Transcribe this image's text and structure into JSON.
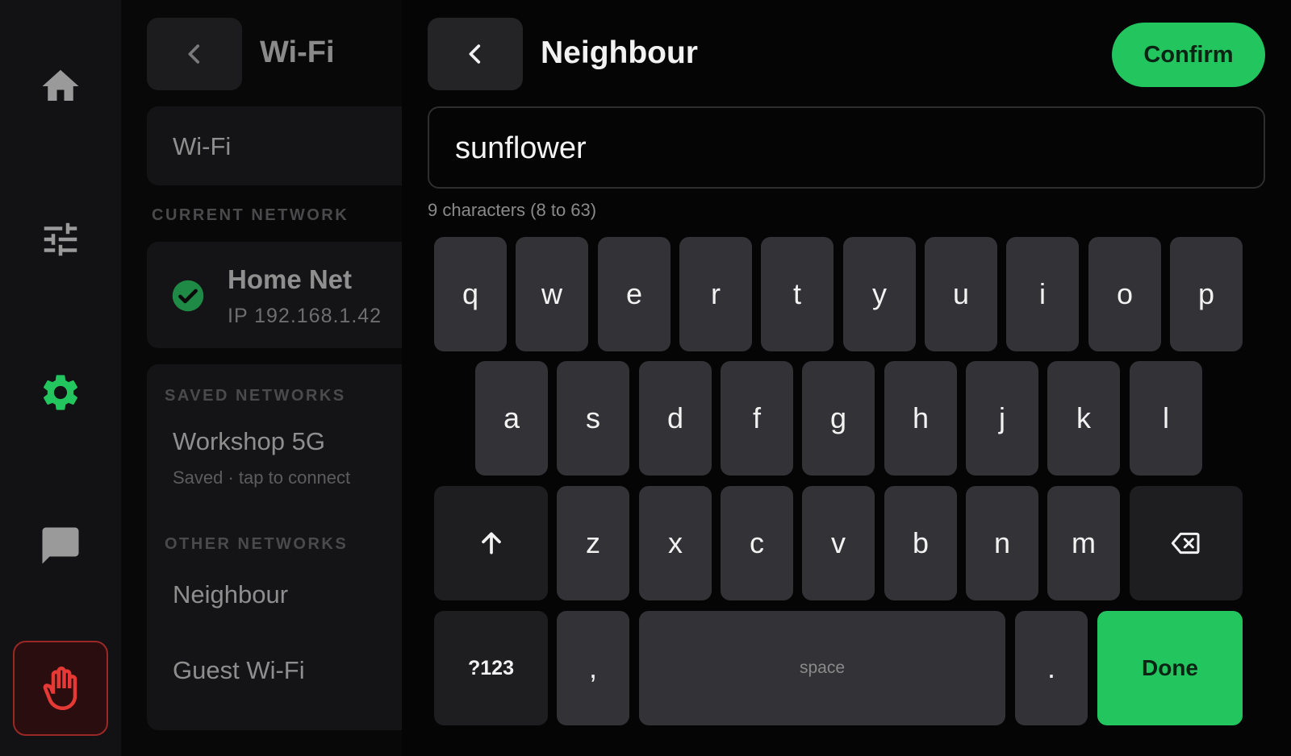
{
  "rail": {
    "items": [
      {
        "icon": "home-icon",
        "color": "#9a9a9a"
      },
      {
        "icon": "sliders-icon",
        "color": "#9a9a9a"
      },
      {
        "icon": "gear-icon",
        "color": "#22c55e"
      },
      {
        "icon": "chat-icon",
        "color": "#9a9a9a"
      }
    ],
    "estop": {
      "icon": "hand-stop-icon",
      "color": "#e53935"
    }
  },
  "panel": {
    "title": "Wi-Fi",
    "wifi_toggle_label": "Wi-Fi",
    "current_header": "CURRENT NETWORK",
    "current": {
      "name": "Home Net",
      "ip": "IP  192.168.1.42"
    },
    "saved_header": "SAVED NETWORKS",
    "saved": [
      {
        "name": "Workshop 5G",
        "sub": "Saved · tap to connect"
      }
    ],
    "other_header": "OTHER NETWORKS",
    "other": [
      {
        "name": "Neighbour"
      },
      {
        "name": "Guest Wi-Fi"
      }
    ]
  },
  "editor": {
    "title": "Neighbour",
    "confirm_label": "Confirm",
    "input_value": "sunflower",
    "hint": "9 characters (8 to 63)"
  },
  "keyboard": {
    "row1": [
      "q",
      "w",
      "e",
      "r",
      "t",
      "y",
      "u",
      "i",
      "o",
      "p"
    ],
    "row2": [
      "a",
      "s",
      "d",
      "f",
      "g",
      "h",
      "j",
      "k",
      "l"
    ],
    "row3": [
      "z",
      "x",
      "c",
      "v",
      "b",
      "n",
      "m"
    ],
    "shift_icon": "arrow-up-icon",
    "backspace_icon": "backspace-icon",
    "symbols_label": "?123",
    "comma_label": ",",
    "space_label": "space",
    "period_label": ".",
    "done_label": "Done"
  },
  "colors": {
    "accent": "#22c55e",
    "danger": "#e53935"
  }
}
